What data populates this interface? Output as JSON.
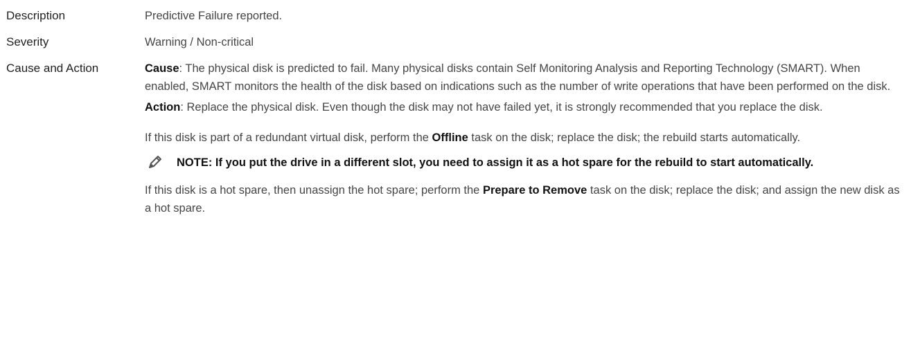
{
  "rows": {
    "description": {
      "label": "Description",
      "value": "Predictive Failure reported."
    },
    "severity": {
      "label": "Severity",
      "value": "Warning / Non-critical"
    },
    "cause_action": {
      "label": "Cause and Action",
      "cause_term": "Cause",
      "cause_text": ": The physical disk is predicted to fail. Many physical disks contain Self Monitoring Analysis and Reporting Technology (SMART). When enabled, SMART monitors the health of the disk based on indications such as the number of write operations that have been performed on the disk.",
      "action_term": "Action",
      "action_text": ": Replace the physical disk. Even though the disk may not have failed yet, it is strongly recommended that you replace the disk.",
      "redundant_text_1": "If this disk is part of a redundant virtual disk, perform the ",
      "redundant_term": "Offline",
      "redundant_text_2": " task on the disk; replace the disk; the rebuild starts automatically.",
      "note_text": "NOTE: If you put the drive in a different slot, you need to assign it as a hot spare for the rebuild to start automatically.",
      "hotspare_text_1": "If this disk is a hot spare, then unassign the hot spare; perform the ",
      "hotspare_term": "Prepare to Remove",
      "hotspare_text_2": " task on the disk; replace the disk; and assign the new disk as a hot spare."
    }
  },
  "icons": {
    "note": "pencil-note-icon"
  }
}
